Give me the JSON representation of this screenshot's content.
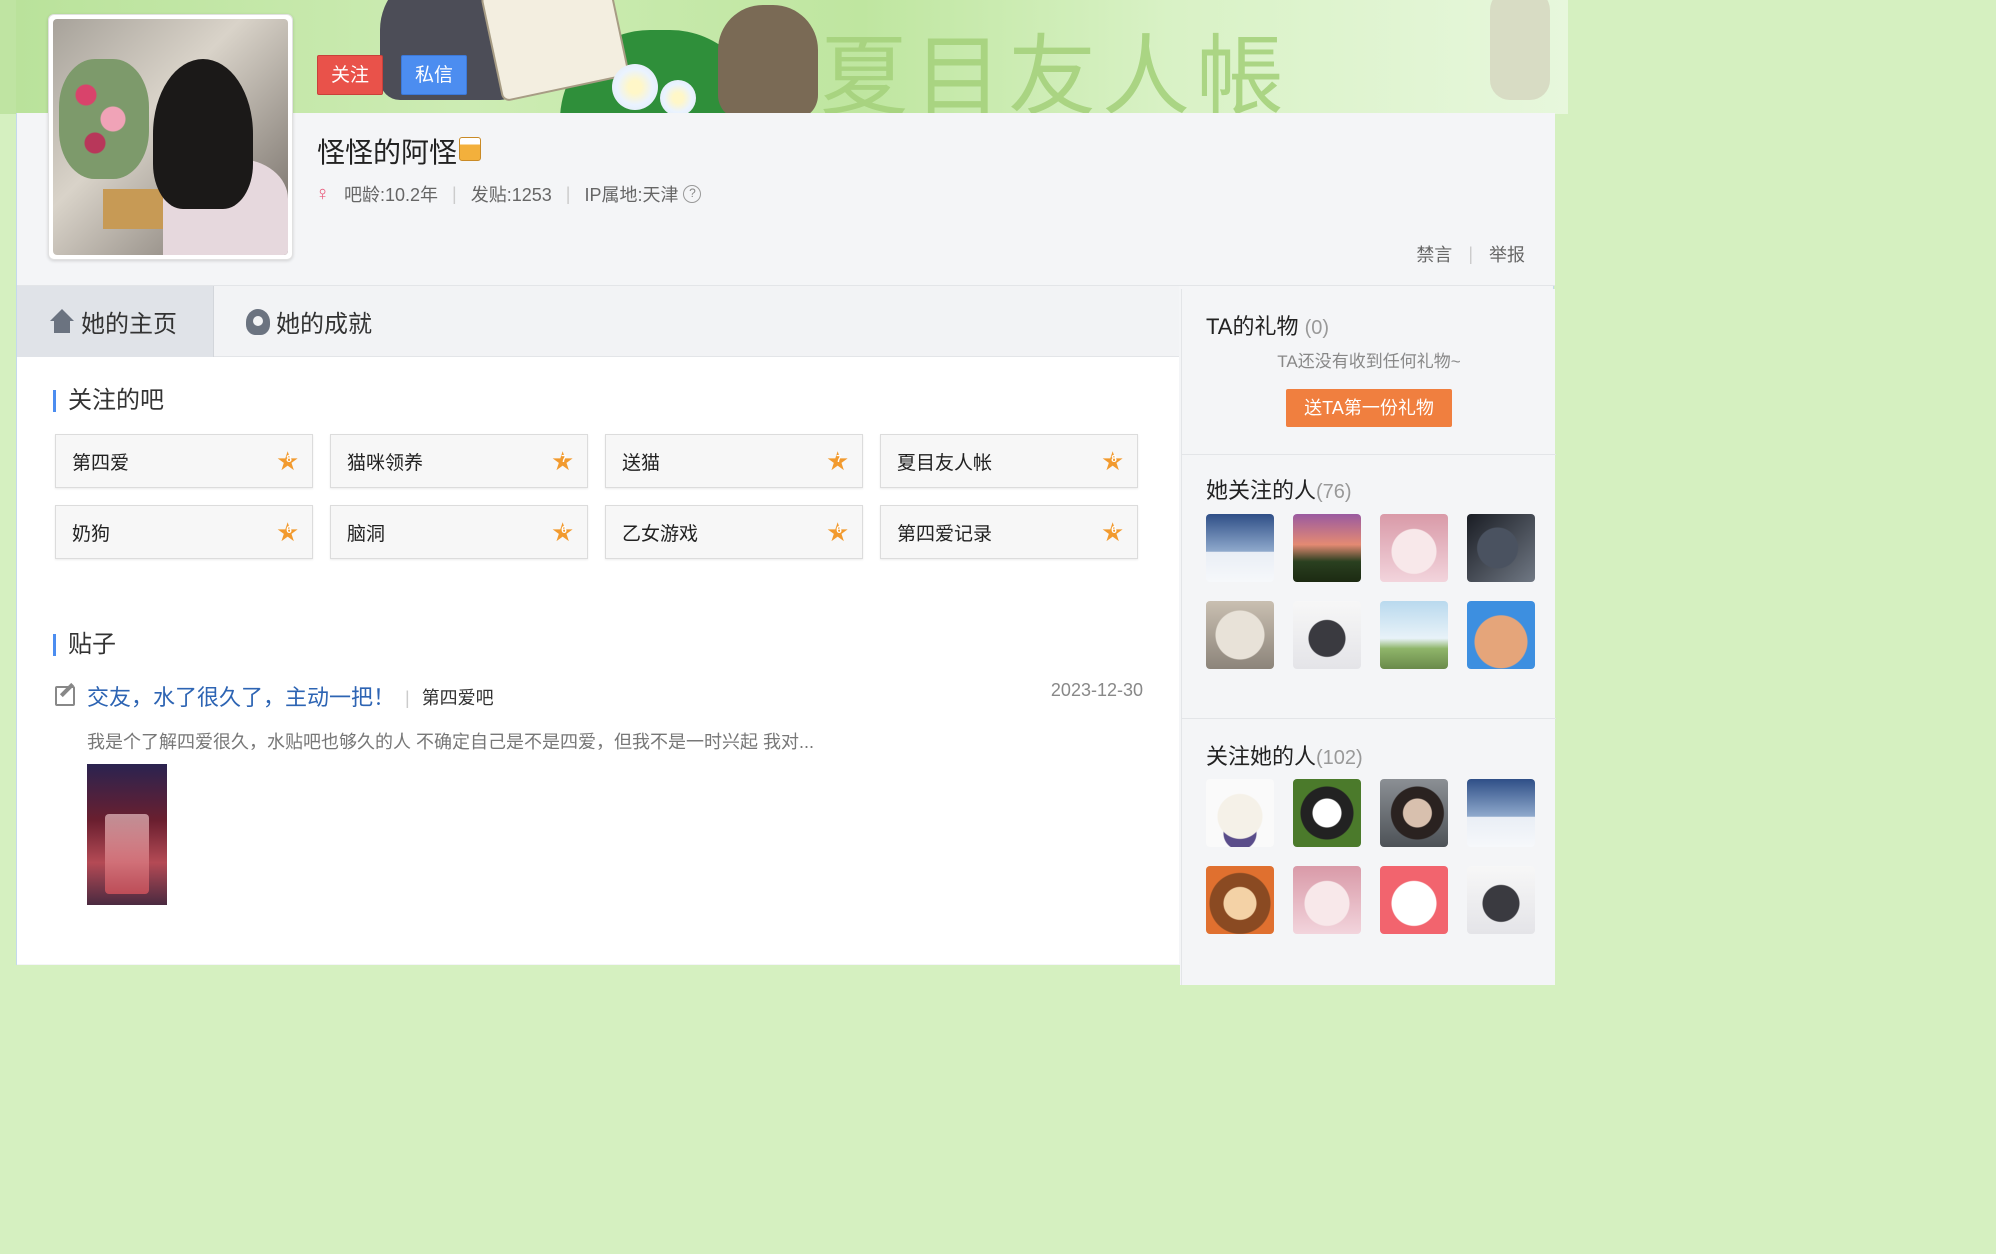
{
  "profile": {
    "username": "怪怪的阿怪",
    "follow_label": "关注",
    "message_label": "私信",
    "bar_age": "吧龄:10.2年",
    "posts": "发贴:1253",
    "ip": "IP属地:天津",
    "ban_label": "禁言",
    "report_label": "举报",
    "gender_symbol": "♀"
  },
  "tabs": [
    {
      "label": "她的主页"
    },
    {
      "label": "她的成就"
    }
  ],
  "followed_bars": {
    "title": "关注的吧",
    "items": [
      {
        "name": "第四爱"
      },
      {
        "name": "猫咪领养"
      },
      {
        "name": "送猫"
      },
      {
        "name": "夏目友人帐"
      },
      {
        "name": "奶狗"
      },
      {
        "name": "脑洞"
      },
      {
        "name": "乙女游戏"
      },
      {
        "name": "第四爱记录"
      }
    ]
  },
  "posts_section": {
    "title": "贴子",
    "post": {
      "title": "交友，水了很久了，主动一把！",
      "bar": "第四爱吧",
      "date": "2023-12-30",
      "excerpt": "我是个了解四爱很久，水贴吧也够久的人 不确定自己是不是四爱，但我不是一时兴起 我对..."
    }
  },
  "gifts": {
    "title": "TA的礼物",
    "count": "(0)",
    "empty_text": "TA还没有收到任何礼物~",
    "send_label": "送TA第一份礼物"
  },
  "following": {
    "title": "她关注的人",
    "count": "(76)"
  },
  "followers": {
    "title": "关注她的人",
    "count": "(102)"
  },
  "colors": {
    "accent_blue": "#4c8df0",
    "follow_red": "#e9524a",
    "gift_orange": "#f07f3f",
    "link_blue": "#2d64b3"
  }
}
